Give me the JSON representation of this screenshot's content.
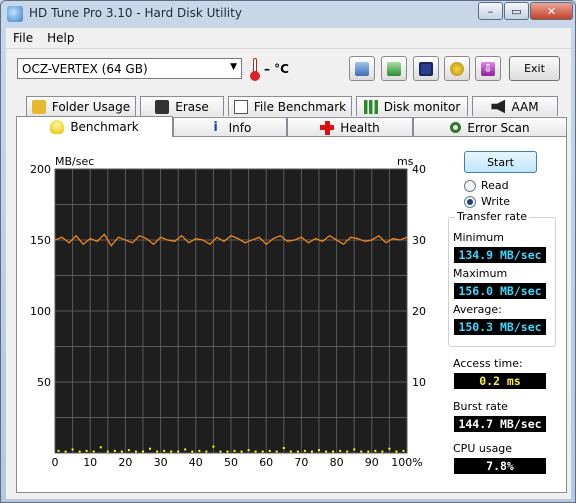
{
  "window": {
    "title": "HD Tune Pro 3.10 - Hard Disk Utility",
    "minimize": "–",
    "maximize": "▭",
    "close": "✕"
  },
  "menu": {
    "file": "File",
    "help": "Help"
  },
  "toolbar": {
    "drive": "OCZ-VERTEX (64 GB)",
    "temperature": "– °C",
    "exit_label": "Exit"
  },
  "tabs": {
    "row1": [
      "Folder Usage",
      "Erase",
      "File Benchmark",
      "Disk monitor",
      "AAM"
    ],
    "row2": [
      "Benchmark",
      "Info",
      "Health",
      "Error Scan"
    ],
    "active": "Benchmark"
  },
  "benchmark": {
    "start_label": "Start",
    "mode_read": "Read",
    "mode_write": "Write",
    "selected_mode": "Write",
    "transfer_rate_title": "Transfer rate",
    "minimum_label": "Minimum",
    "minimum_value": "134.9 MB/sec",
    "maximum_label": "Maximum",
    "maximum_value": "156.0 MB/sec",
    "average_label": "Average:",
    "average_value": "150.3 MB/sec",
    "access_label": "Access time:",
    "access_value": "0.2 ms",
    "burst_label": "Burst rate",
    "burst_value": "144.7 MB/sec",
    "cpu_label": "CPU usage",
    "cpu_value": "7.8%"
  },
  "chart_data": {
    "type": "line",
    "left_unit": "MB/sec",
    "right_unit": "ms",
    "y_left_ticks": [
      "200",
      "150",
      "100",
      "50"
    ],
    "y_right_ticks": [
      "40",
      "30",
      "20",
      "10"
    ],
    "x_ticks": [
      "0",
      "10",
      "20",
      "30",
      "40",
      "50",
      "60",
      "70",
      "80",
      "90",
      "100%"
    ],
    "ylim_left": [
      0,
      200
    ],
    "ylim_right": [
      0,
      40
    ],
    "xlim": [
      0,
      100
    ],
    "grid": true,
    "colors": {
      "background": "#1e1e1e",
      "grid": "#5a5a5a",
      "transfer": "#ff8c1a",
      "access": "#ffff00"
    },
    "series": [
      {
        "values_x": [
          0,
          2,
          4,
          6,
          8,
          10,
          12,
          14,
          16,
          18,
          20,
          22,
          24,
          26,
          28,
          30,
          32,
          34,
          36,
          38,
          40,
          42,
          44,
          46,
          48,
          50,
          52,
          54,
          56,
          58,
          60,
          62,
          64,
          66,
          68,
          70,
          72,
          74,
          76,
          78,
          80,
          82,
          84,
          86,
          88,
          90,
          92,
          94,
          96,
          98,
          100
        ],
        "values_y": [
          150,
          152,
          148,
          153,
          147,
          151,
          149,
          154,
          146,
          152,
          150,
          148,
          153,
          151,
          147,
          152,
          150,
          149,
          153,
          148,
          151,
          150,
          147,
          152,
          149,
          153,
          151,
          148,
          150,
          152,
          147,
          151,
          153,
          149,
          150,
          152,
          148,
          151,
          149,
          153,
          150,
          147,
          152,
          151,
          149,
          150,
          153,
          148,
          151,
          150,
          152
        ]
      }
    ],
    "access_points": {
      "x": [
        1,
        3,
        5,
        7,
        9,
        11,
        13,
        15,
        17,
        19,
        21,
        23,
        25,
        27,
        29,
        31,
        33,
        35,
        37,
        39,
        41,
        43,
        45,
        47,
        49,
        51,
        53,
        55,
        57,
        59,
        61,
        63,
        65,
        67,
        69,
        71,
        73,
        75,
        77,
        79,
        81,
        83,
        85,
        87,
        89,
        91,
        93,
        95,
        97,
        99
      ],
      "y": [
        0.3,
        0.2,
        0.5,
        0.2,
        0.3,
        0.2,
        0.8,
        0.2,
        0.3,
        0.2,
        0.4,
        0.2,
        0.2,
        0.6,
        0.2,
        0.3,
        0.2,
        0.2,
        0.5,
        0.2,
        0.3,
        0.2,
        0.9,
        0.2,
        0.2,
        0.3,
        0.2,
        0.4,
        0.2,
        0.2,
        0.3,
        0.2,
        0.7,
        0.2,
        0.2,
        0.3,
        0.2,
        0.4,
        0.2,
        0.2,
        0.3,
        0.2,
        0.5,
        0.2,
        0.2,
        0.3,
        0.2,
        0.6,
        0.2,
        0.3
      ]
    }
  }
}
